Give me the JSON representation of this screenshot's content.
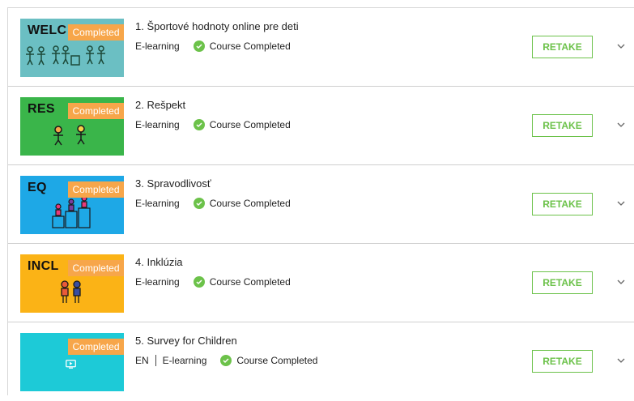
{
  "courses": [
    {
      "number_title": "1. Športové hodnoty online pre deti",
      "lang": "",
      "type": "E-learning",
      "status": "Course Completed",
      "badge": "Completed",
      "thumb_text": "WELC",
      "thumb_color": "#6bbfc3",
      "action": "RETAKE"
    },
    {
      "number_title": "2. Rešpekt",
      "lang": "",
      "type": "E-learning",
      "status": "Course Completed",
      "badge": "Completed",
      "thumb_text": "RES",
      "thumb_color": "#3ab54a",
      "action": "RETAKE"
    },
    {
      "number_title": "3. Spravodlivosť",
      "lang": "",
      "type": "E-learning",
      "status": "Course Completed",
      "badge": "Completed",
      "thumb_text": "EQ",
      "thumb_color": "#1ea8e6",
      "action": "RETAKE"
    },
    {
      "number_title": "4. Inklúzia",
      "lang": "",
      "type": "E-learning",
      "status": "Course Completed",
      "badge": "Completed",
      "thumb_text": "INCL",
      "thumb_color": "#fbb316",
      "action": "RETAKE"
    },
    {
      "number_title": "5. Survey for Children",
      "lang": "EN",
      "type": "E-learning",
      "status": "Course Completed",
      "badge": "Completed",
      "thumb_text": "",
      "thumb_color": "#1dcad7",
      "action": "RETAKE"
    }
  ],
  "colors": {
    "accent_green": "#6cc24a",
    "badge_orange": "#f7a64a"
  },
  "icons": {
    "status": "check-circle-icon",
    "expand": "chevron-down-icon",
    "survey": "play-icon"
  }
}
